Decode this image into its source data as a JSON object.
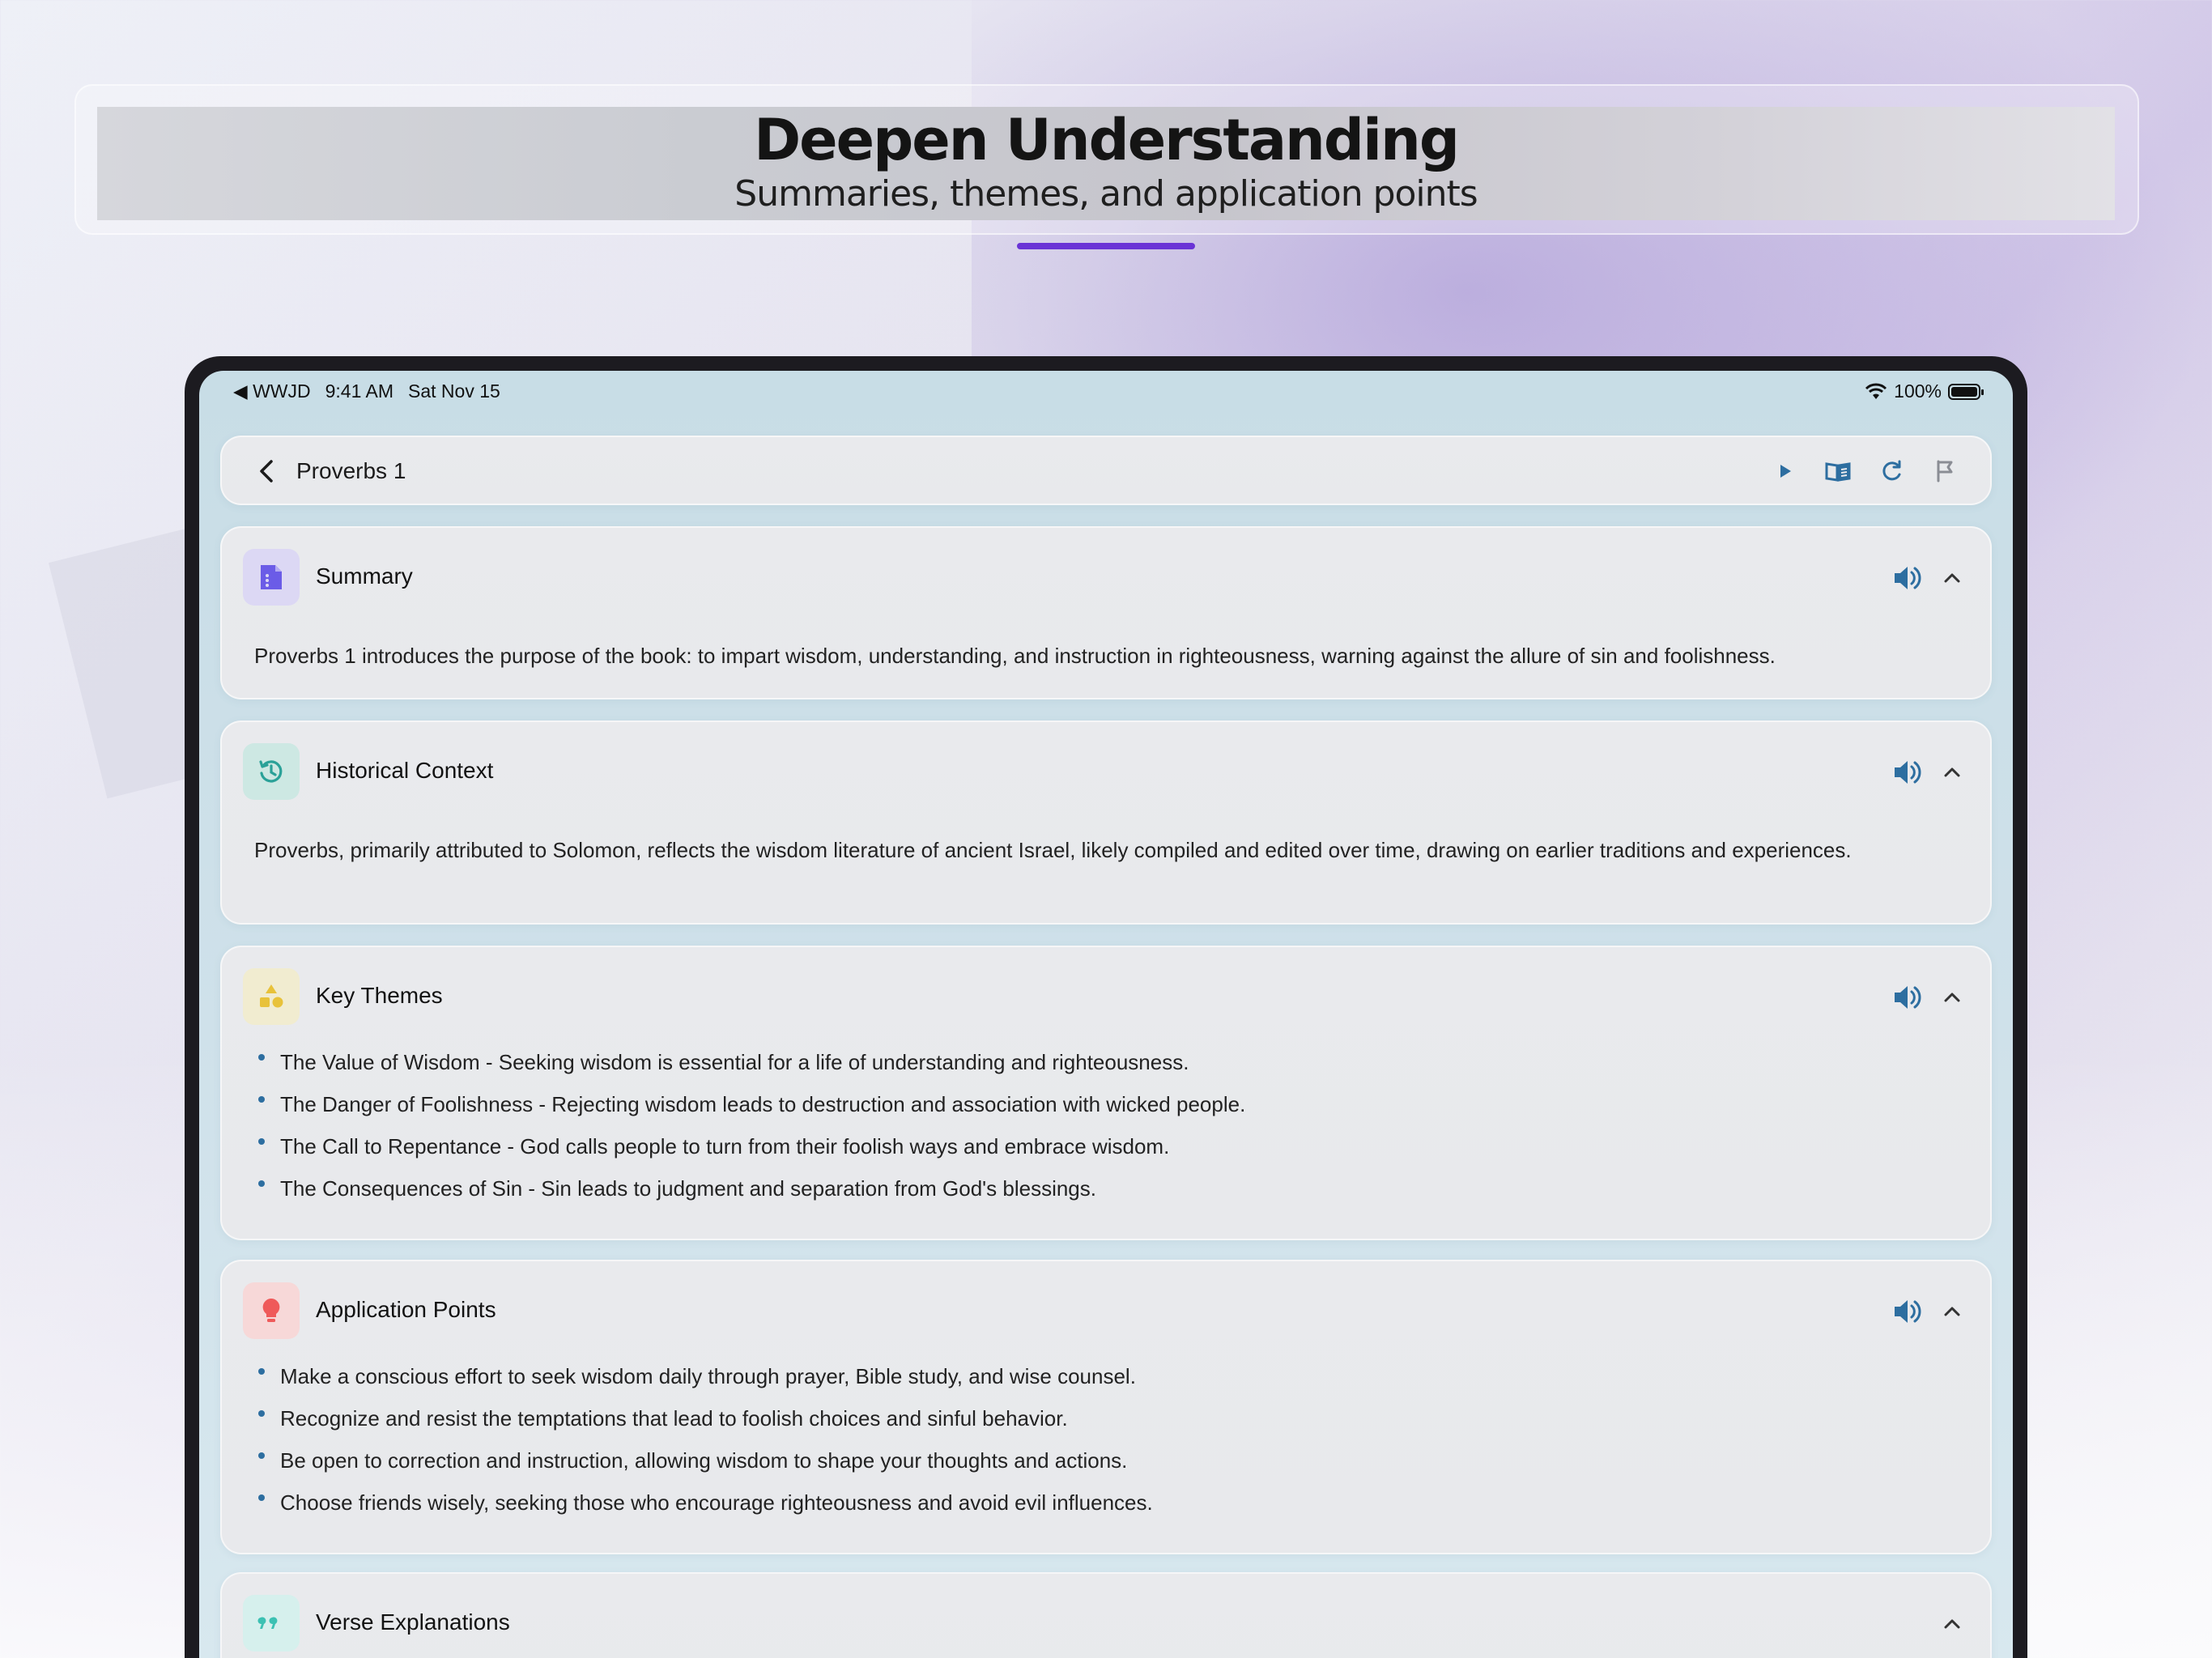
{
  "banner": {
    "title": "Deepen Understanding",
    "subtitle": "Summaries, themes, and application points"
  },
  "status_bar": {
    "carrier": "◀ WWJD",
    "time": "9:41 AM",
    "date": "Sat Nov 15",
    "battery": "100%"
  },
  "nav": {
    "title": "Proverbs 1",
    "actions": [
      "play-icon",
      "book-icon",
      "refresh-icon",
      "flag-icon"
    ]
  },
  "colors": {
    "accent": "#6a33d6",
    "action_blue": "#2d6ea0",
    "summary_icon": "#6b5ce7",
    "history_icon": "#2aa198",
    "themes_icon": "#e8c23a",
    "application_icon": "#ef5a5a",
    "verse_icon": "#3cc1b3"
  },
  "sections": [
    {
      "title": "Summary",
      "icon": "document-icon",
      "text": "Proverbs 1 introduces the purpose of the book: to impart wisdom, understanding, and instruction in righteousness, warning against the allure of sin and foolishness."
    },
    {
      "title": "Historical Context",
      "icon": "history-icon",
      "text": "Proverbs, primarily attributed to Solomon, reflects the wisdom literature of ancient Israel, likely compiled and edited over time, drawing on earlier traditions and experiences."
    },
    {
      "title": "Key Themes",
      "icon": "shapes-icon",
      "items": [
        "The Value of Wisdom - Seeking wisdom is essential for a life of understanding and righteousness.",
        "The Danger of Foolishness - Rejecting wisdom leads to destruction and association with wicked people.",
        "The Call to Repentance - God calls people to turn from their foolish ways and embrace wisdom.",
        "The Consequences of Sin - Sin leads to judgment and separation from God's blessings."
      ]
    },
    {
      "title": "Application Points",
      "icon": "lightbulb-icon",
      "items": [
        "Make a conscious effort to seek wisdom daily through prayer, Bible study, and wise counsel.",
        "Recognize and resist the temptations that lead to foolish choices and sinful behavior.",
        "Be open to correction and instruction, allowing wisdom to shape your thoughts and actions.",
        "Choose friends wisely, seeking those who encourage righteousness and avoid evil influences."
      ]
    },
    {
      "title": "Verse Explanations",
      "icon": "quote-icon"
    }
  ]
}
